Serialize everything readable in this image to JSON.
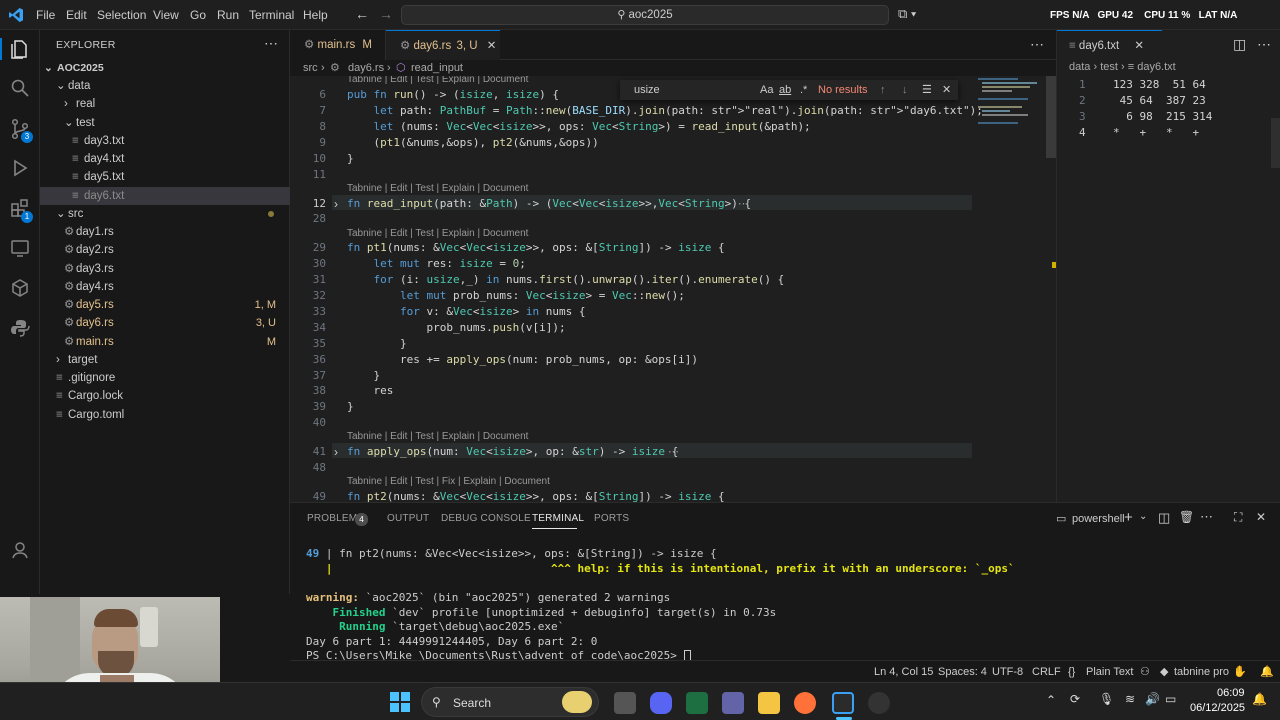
{
  "titlebar": {
    "menus": [
      "File",
      "Edit",
      "Selection",
      "View",
      "Go",
      "Run",
      "Terminal",
      "Help"
    ],
    "command_center": "aoc2025",
    "overlay": {
      "fps_label": "FPS",
      "fps": "N/A",
      "gpu_label": "GPU",
      "gpu": "42",
      "cpu_label": "CPU",
      "cpu": "11 %",
      "lat_label": "LAT",
      "lat": "N/A"
    }
  },
  "activity": {
    "scm_badge": "3",
    "ext_badge": "1"
  },
  "explorer": {
    "title": "EXPLORER",
    "root": "AOC2025",
    "items": [
      {
        "label": "data",
        "kind": "folder-open",
        "depth": 1
      },
      {
        "label": "real",
        "kind": "folder",
        "depth": 2
      },
      {
        "label": "test",
        "kind": "folder-open",
        "depth": 2
      },
      {
        "label": "day3.txt",
        "kind": "file",
        "depth": 3
      },
      {
        "label": "day4.txt",
        "kind": "file",
        "depth": 3
      },
      {
        "label": "day5.txt",
        "kind": "file",
        "depth": 3
      },
      {
        "label": "day6.txt",
        "kind": "file",
        "depth": 3,
        "selected": true
      },
      {
        "label": "src",
        "kind": "folder-open",
        "depth": 1,
        "dot": true
      },
      {
        "label": "day1.rs",
        "kind": "rs",
        "depth": 2
      },
      {
        "label": "day2.rs",
        "kind": "rs",
        "depth": 2
      },
      {
        "label": "day3.rs",
        "kind": "rs",
        "depth": 2
      },
      {
        "label": "day4.rs",
        "kind": "rs",
        "depth": 2
      },
      {
        "label": "day5.rs",
        "kind": "rs",
        "depth": 2,
        "status": "1, M",
        "color": "#e2c08d"
      },
      {
        "label": "day6.rs",
        "kind": "rs",
        "depth": 2,
        "status": "3, U",
        "color": "#e2c08d"
      },
      {
        "label": "main.rs",
        "kind": "rs",
        "depth": 2,
        "status": "M",
        "color": "#e2c08d"
      },
      {
        "label": "target",
        "kind": "folder",
        "depth": 1
      },
      {
        "label": ".gitignore",
        "kind": "file",
        "depth": 1
      },
      {
        "label": "Cargo.lock",
        "kind": "file",
        "depth": 1
      },
      {
        "label": "Cargo.toml",
        "kind": "file",
        "depth": 1
      }
    ]
  },
  "tabs": [
    {
      "label": "main.rs",
      "status": "M"
    },
    {
      "label": "day6.rs",
      "status": "3, U",
      "active": true
    }
  ],
  "breadcrumb": {
    "a": "src",
    "b": "day6.rs",
    "c": "read_input"
  },
  "find": {
    "query": "usize",
    "result": "No results",
    "aa": "Aa",
    "ab": "ab"
  },
  "editor_lens": {
    "standard": "Tabnine | Edit | Test | Explain | Document",
    "fix": "Tabnine | Edit | Test | Fix | Explain | Document"
  },
  "editor_lines": [
    {
      "n": "6",
      "t": "pub fn run() -> (isize, isize) {"
    },
    {
      "n": "7",
      "t": "    let path: PathBuf = Path::new(BASE_DIR).join(path: \"real\").join(path: \"day6.txt\");"
    },
    {
      "n": "8",
      "t": "    let (nums: Vec<Vec<isize>>, ops: Vec<String>) = read_input(&path);"
    },
    {
      "n": "9",
      "t": "    (pt1(&nums,&ops), pt2(&nums,&ops))"
    },
    {
      "n": "10",
      "t": "}"
    },
    {
      "n": "11",
      "t": ""
    },
    {
      "n": "12",
      "t": "fn read_input(path: &Path) -> (Vec<Vec<isize>>,Vec<String>) {"
    },
    {
      "n": "28",
      "t": ""
    },
    {
      "n": "29",
      "t": "fn pt1(nums: &Vec<Vec<isize>>, ops: &[String]) -> isize {"
    },
    {
      "n": "30",
      "t": "    let mut res: isize = 0;"
    },
    {
      "n": "31",
      "t": "    for (i: usize,_) in nums.first().unwrap().iter().enumerate() {"
    },
    {
      "n": "32",
      "t": "        let mut prob_nums: Vec<isize> = Vec::new();"
    },
    {
      "n": "33",
      "t": "        for v: &Vec<isize> in nums {"
    },
    {
      "n": "34",
      "t": "            prob_nums.push(v[i]);"
    },
    {
      "n": "35",
      "t": "        }"
    },
    {
      "n": "36",
      "t": "        res += apply_ops(num: prob_nums, op: &ops[i])"
    },
    {
      "n": "37",
      "t": "    }"
    },
    {
      "n": "38",
      "t": "    res"
    },
    {
      "n": "39",
      "t": "}"
    },
    {
      "n": "40",
      "t": ""
    },
    {
      "n": "41",
      "t": "fn apply_ops(num: Vec<isize>, op: &str) -> isize {"
    },
    {
      "n": "48",
      "t": ""
    },
    {
      "n": "49",
      "t": "fn pt2(nums: &Vec<Vec<isize>>, ops: &[String]) -> isize {"
    }
  ],
  "right_pane": {
    "tab": "day6.txt",
    "crumb": {
      "a": "data",
      "b": "test",
      "c": "day6.txt"
    },
    "lines": [
      {
        "n": "1",
        "t": "123 328  51 64"
      },
      {
        "n": "2",
        "t": " 45 64  387 23"
      },
      {
        "n": "3",
        "t": "  6 98  215 314"
      },
      {
        "n": "4",
        "t": "*   +   *   +"
      }
    ]
  },
  "panel": {
    "tabs": [
      "PROBLEMS",
      "OUTPUT",
      "DEBUG CONSOLE",
      "TERMINAL",
      "PORTS"
    ],
    "problems_badge": "4",
    "shell": "powershell",
    "lines": [
      {
        "a": "49",
        "b": " | fn pt2(nums: &Vec<Vec<isize>>, ops: &[String]) -> isize {"
      },
      {
        "a": "",
        "b": "   |                                 ^^^ help: if this is intentional, prefix it with an underscore: `_ops`"
      },
      {
        "a": "",
        "b": ""
      },
      {
        "a": "warning:",
        "b": " `aoc2025` (bin \"aoc2025\") generated 2 warnings"
      },
      {
        "a": "    Finished",
        "b": " `dev` profile [unoptimized + debuginfo] target(s) in 0.73s"
      },
      {
        "a": "     Running",
        "b": " `target\\debug\\aoc2025.exe`"
      },
      {
        "a": "",
        "b": "Day 6 part 1: 4449991244405, Day 6 part 2: 0"
      },
      {
        "a": "",
        "b": "PS C:\\Users\\Mike_\\Documents\\Rust\\advent_of_code\\aoc2025> "
      }
    ]
  },
  "status": {
    "pos": "Ln 4, Col 15",
    "spaces": "Spaces: 4",
    "enc": "UTF-8",
    "eol": "CRLF",
    "lang": "Plain Text",
    "tabnine": "tabnine pro"
  },
  "taskbar": {
    "search": "Search",
    "time": "06:09",
    "date": "06/12/2025"
  },
  "colors": {
    "accent": "#0078d4",
    "modified": "#e2c08d",
    "keyword": "#569cd6",
    "type": "#4ec9b0",
    "function": "#dcdcaa",
    "string": "#ce9178"
  }
}
